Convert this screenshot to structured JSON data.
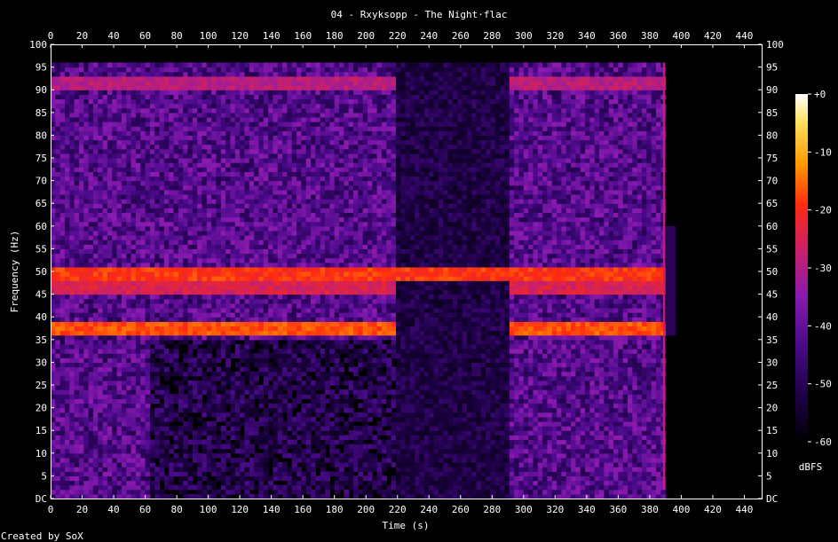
{
  "title": "04 - Rxyksopp - The Night·flac",
  "footer": "Created by SoX",
  "chart_data": {
    "type": "heatmap",
    "title": "04 - Rxyksopp - The Night·flac",
    "xlabel": "Time (s)",
    "ylabel": "Frequency (Hz)",
    "xlim": [
      0,
      451
    ],
    "ylim": [
      0,
      100
    ],
    "x_ticks": [
      "0",
      "20",
      "40",
      "60",
      "80",
      "100",
      "120",
      "140",
      "160",
      "180",
      "200",
      "220",
      "240",
      "260",
      "280",
      "300",
      "320",
      "340",
      "360",
      "380",
      "400",
      "420",
      "440"
    ],
    "y_ticks": [
      "DC",
      "5",
      "10",
      "15",
      "20",
      "25",
      "30",
      "35",
      "40",
      "45",
      "50",
      "55",
      "60",
      "65",
      "70",
      "75",
      "80",
      "85",
      "90",
      "95",
      "100"
    ],
    "colorbar": {
      "label": "dBFS",
      "range": [
        -60,
        0
      ],
      "ticks": [
        "+0",
        "-10",
        "-20",
        "-30",
        "-40",
        "-50",
        "-60"
      ],
      "colors": [
        "#000000",
        "#1a0040",
        "#4a0a8a",
        "#8a1ab0",
        "#c8206a",
        "#ff2a10",
        "#ff9a00",
        "#ffe060",
        "#ffffff"
      ]
    },
    "features": {
      "content_top_hz": 96,
      "fade_out_end_s": 389,
      "quiet_region_s": [
        218,
        290
      ],
      "tones": [
        {
          "freq_hz": 49,
          "level_db": -22
        },
        {
          "freq_hz": 46,
          "level_db": -28
        },
        {
          "freq_hz": 37,
          "level_db": -20
        },
        {
          "freq_hz": 91,
          "level_db": -32
        }
      ]
    }
  }
}
